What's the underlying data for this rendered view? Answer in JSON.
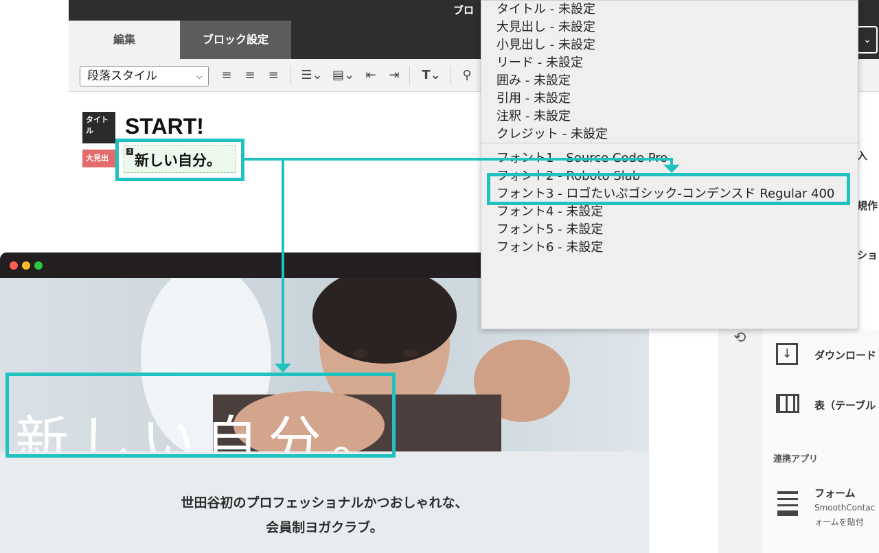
{
  "editor": {
    "title_partial": "ブロ",
    "tabs": [
      {
        "label": "編集"
      },
      {
        "label": "ブロック設定"
      }
    ],
    "right_select_caret": "⌄",
    "toolbar": {
      "paragraph_style": "段落スタイル",
      "icons": [
        "align-left-icon",
        "align-center-icon",
        "align-right-icon",
        "bullet-list-icon",
        "block-format-icon",
        "outdent-icon",
        "indent-icon",
        "text-style-icon",
        "link-icon"
      ]
    },
    "canvas": {
      "badge_title": "タイトル",
      "badge_midashi": "大見出",
      "title_text": "START!",
      "heading_number": "3",
      "heading_text": "新しい自分。"
    }
  },
  "dropdown": {
    "items_top": [
      "タイトル - 未設定",
      "大見出し - 未設定",
      "小見出し - 未設定",
      "リード - 未設定",
      "囲み - 未設定",
      "引用 - 未設定",
      "注釈 - 未設定",
      "クレジット - 未設定"
    ],
    "items_fonts": [
      "フォント1 - Source Code Pro",
      "フォント2 - Roboto Slab",
      "フォント3 - ロゴたいぷゴシック-コンデンスド Regular 400",
      "フォント4 - 未設定",
      "フォント5 - 未設定",
      "フォント6 - 未設定"
    ]
  },
  "right_panel": {
    "clipped_1": "入",
    "clipped_2": "規作",
    "clipped_3": "ショ",
    "download": "ダウンロード",
    "table": "表（テーブル",
    "linked_apps": "連携アプリ",
    "form": "フォーム",
    "form_sub1": "SmoothContac",
    "form_sub2": "ォームを貼付"
  },
  "browser": {
    "hero_text": "新しい自分。",
    "tagline_1": "世田谷初のプロフェッショナルかつおしゃれな、",
    "tagline_2": "会員制ヨガクラブ。"
  },
  "colors": {
    "highlight": "#1fc1c1",
    "dark_bar": "#2e2e2e",
    "badge_red": "#e36b6b"
  }
}
